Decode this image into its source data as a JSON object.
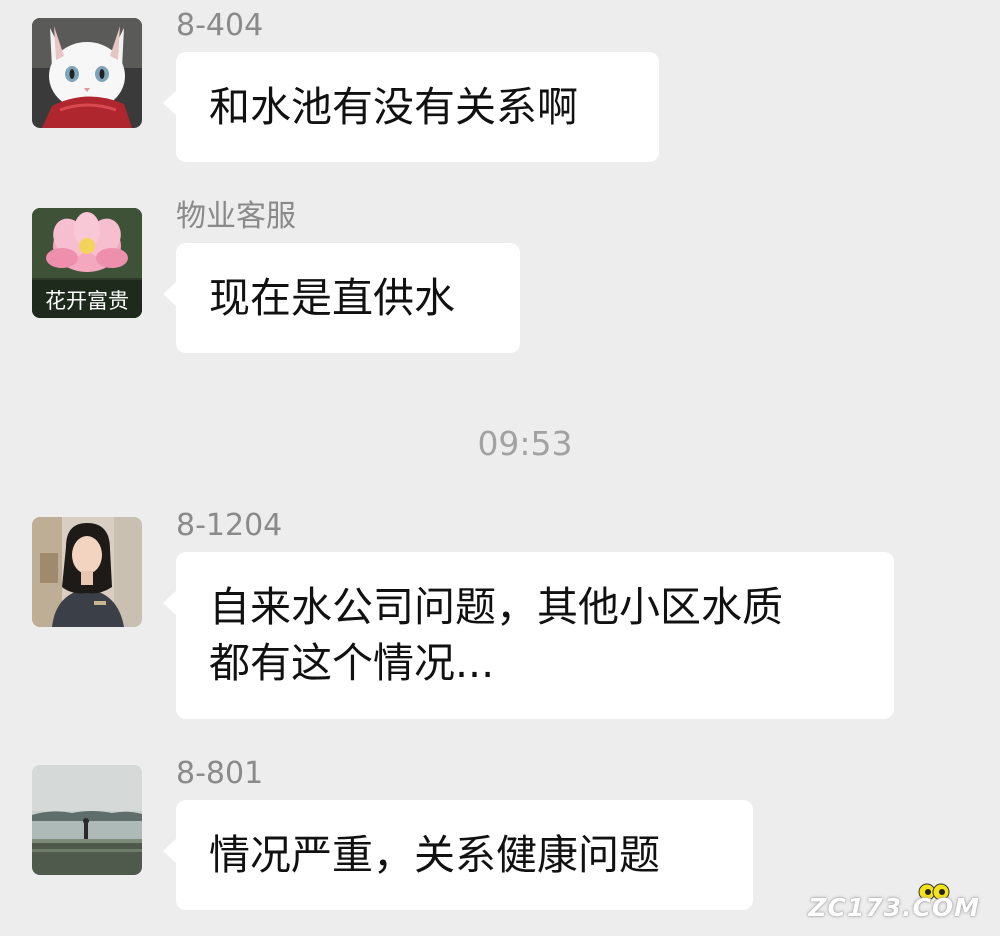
{
  "chat": {
    "messages": [
      {
        "sender": "8-404",
        "avatar": "white-cat-with-red-scarf",
        "lines": [
          "和水池有没有关系啊"
        ]
      },
      {
        "sender": "物业客服",
        "avatar": "pink-lotus-flower",
        "avatar_caption": "花开富贵",
        "lines": [
          "现在是直供水"
        ]
      },
      {
        "sender": "8-1204",
        "avatar": "woman-portrait",
        "lines": [
          "自来水公司问题，其他小区水质",
          "都有这个情况..."
        ]
      },
      {
        "sender": "8-801",
        "avatar": "lake-landscape",
        "lines": [
          "情况严重，关系健康问题"
        ]
      }
    ],
    "timestamp": "09:53"
  },
  "watermark": {
    "text": "ZC173.COM"
  },
  "colors": {
    "background": "#ededed",
    "bubble": "#ffffff",
    "sender_name": "#8a8a8a",
    "timestamp": "#a2a2a2"
  }
}
